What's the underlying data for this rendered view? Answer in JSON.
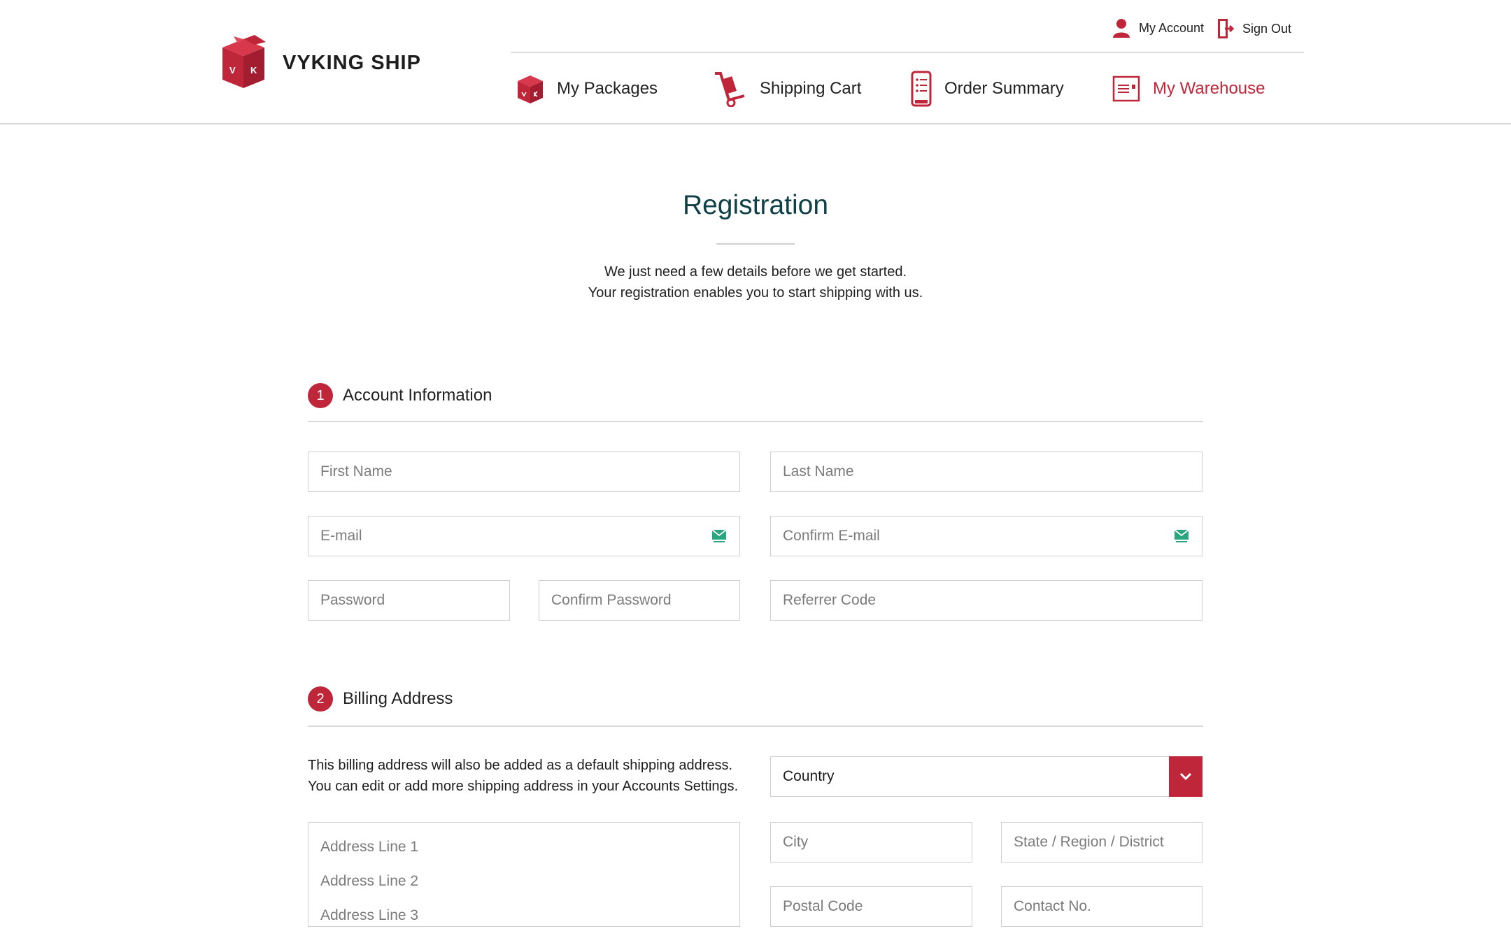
{
  "brand": {
    "name": "VYKING SHIP",
    "logo_letters": [
      "V",
      "K"
    ],
    "accent_color": "#c0263a",
    "title_color": "#0f4047"
  },
  "utility_nav": {
    "my_account": "My Account",
    "sign_out": "Sign Out"
  },
  "main_nav": {
    "items": [
      {
        "label": "My Packages",
        "icon": "package-icon",
        "active": false
      },
      {
        "label": "Shipping Cart",
        "icon": "hand-truck-icon",
        "active": false
      },
      {
        "label": "Order Summary",
        "icon": "order-list-icon",
        "active": false
      },
      {
        "label": "My Warehouse",
        "icon": "warehouse-card-icon",
        "active": true
      }
    ]
  },
  "page": {
    "title": "Registration",
    "intro_line1": "We just need a few details before we get started.",
    "intro_line2": "Your registration enables you to start shipping with us."
  },
  "account_section": {
    "step": "1",
    "title": "Account Information",
    "fields": {
      "first_name": {
        "placeholder": "First Name",
        "value": ""
      },
      "last_name": {
        "placeholder": "Last Name",
        "value": ""
      },
      "email": {
        "placeholder": "E-mail",
        "value": ""
      },
      "confirm_email": {
        "placeholder": "Confirm E-mail",
        "value": ""
      },
      "password": {
        "placeholder": "Password",
        "value": ""
      },
      "confirm_password": {
        "placeholder": "Confirm Password",
        "value": ""
      },
      "referrer_code": {
        "placeholder": "Referrer Code",
        "value": ""
      }
    }
  },
  "billing_section": {
    "step": "2",
    "title": "Billing Address",
    "note_line1": "This billing address will also be added as a default shipping address.",
    "note_line2": "You can edit or add more shipping address in your Accounts Settings.",
    "country": {
      "selected": "Country"
    },
    "fields": {
      "address_line1": "Address Line 1",
      "address_line2": "Address Line 2",
      "address_line3": "Address Line 3",
      "city": {
        "placeholder": "City",
        "value": ""
      },
      "state": {
        "placeholder": "State / Region / District",
        "value": ""
      },
      "postal_code": {
        "placeholder": "Postal Code",
        "value": ""
      },
      "contact_no": {
        "placeholder": "Contact No.",
        "value": ""
      }
    }
  }
}
